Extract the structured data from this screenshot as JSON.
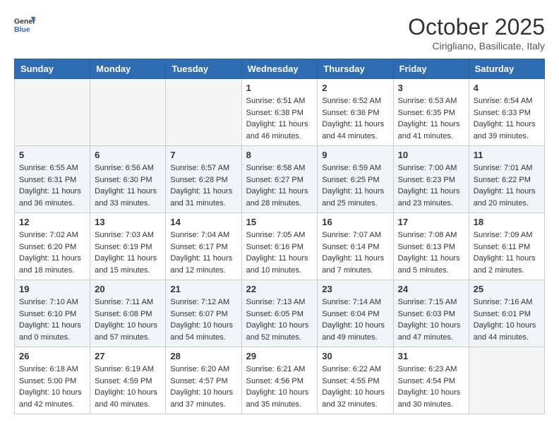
{
  "header": {
    "logo_general": "General",
    "logo_blue": "Blue",
    "month": "October 2025",
    "location": "Cirigliano, Basilicate, Italy"
  },
  "weekdays": [
    "Sunday",
    "Monday",
    "Tuesday",
    "Wednesday",
    "Thursday",
    "Friday",
    "Saturday"
  ],
  "weeks": [
    [
      {
        "day": "",
        "info": ""
      },
      {
        "day": "",
        "info": ""
      },
      {
        "day": "",
        "info": ""
      },
      {
        "day": "1",
        "info": "Sunrise: 6:51 AM\nSunset: 6:38 PM\nDaylight: 11 hours and 46 minutes."
      },
      {
        "day": "2",
        "info": "Sunrise: 6:52 AM\nSunset: 6:36 PM\nDaylight: 11 hours and 44 minutes."
      },
      {
        "day": "3",
        "info": "Sunrise: 6:53 AM\nSunset: 6:35 PM\nDaylight: 11 hours and 41 minutes."
      },
      {
        "day": "4",
        "info": "Sunrise: 6:54 AM\nSunset: 6:33 PM\nDaylight: 11 hours and 39 minutes."
      }
    ],
    [
      {
        "day": "5",
        "info": "Sunrise: 6:55 AM\nSunset: 6:31 PM\nDaylight: 11 hours and 36 minutes."
      },
      {
        "day": "6",
        "info": "Sunrise: 6:56 AM\nSunset: 6:30 PM\nDaylight: 11 hours and 33 minutes."
      },
      {
        "day": "7",
        "info": "Sunrise: 6:57 AM\nSunset: 6:28 PM\nDaylight: 11 hours and 31 minutes."
      },
      {
        "day": "8",
        "info": "Sunrise: 6:58 AM\nSunset: 6:27 PM\nDaylight: 11 hours and 28 minutes."
      },
      {
        "day": "9",
        "info": "Sunrise: 6:59 AM\nSunset: 6:25 PM\nDaylight: 11 hours and 25 minutes."
      },
      {
        "day": "10",
        "info": "Sunrise: 7:00 AM\nSunset: 6:23 PM\nDaylight: 11 hours and 23 minutes."
      },
      {
        "day": "11",
        "info": "Sunrise: 7:01 AM\nSunset: 6:22 PM\nDaylight: 11 hours and 20 minutes."
      }
    ],
    [
      {
        "day": "12",
        "info": "Sunrise: 7:02 AM\nSunset: 6:20 PM\nDaylight: 11 hours and 18 minutes."
      },
      {
        "day": "13",
        "info": "Sunrise: 7:03 AM\nSunset: 6:19 PM\nDaylight: 11 hours and 15 minutes."
      },
      {
        "day": "14",
        "info": "Sunrise: 7:04 AM\nSunset: 6:17 PM\nDaylight: 11 hours and 12 minutes."
      },
      {
        "day": "15",
        "info": "Sunrise: 7:05 AM\nSunset: 6:16 PM\nDaylight: 11 hours and 10 minutes."
      },
      {
        "day": "16",
        "info": "Sunrise: 7:07 AM\nSunset: 6:14 PM\nDaylight: 11 hours and 7 minutes."
      },
      {
        "day": "17",
        "info": "Sunrise: 7:08 AM\nSunset: 6:13 PM\nDaylight: 11 hours and 5 minutes."
      },
      {
        "day": "18",
        "info": "Sunrise: 7:09 AM\nSunset: 6:11 PM\nDaylight: 11 hours and 2 minutes."
      }
    ],
    [
      {
        "day": "19",
        "info": "Sunrise: 7:10 AM\nSunset: 6:10 PM\nDaylight: 11 hours and 0 minutes."
      },
      {
        "day": "20",
        "info": "Sunrise: 7:11 AM\nSunset: 6:08 PM\nDaylight: 10 hours and 57 minutes."
      },
      {
        "day": "21",
        "info": "Sunrise: 7:12 AM\nSunset: 6:07 PM\nDaylight: 10 hours and 54 minutes."
      },
      {
        "day": "22",
        "info": "Sunrise: 7:13 AM\nSunset: 6:05 PM\nDaylight: 10 hours and 52 minutes."
      },
      {
        "day": "23",
        "info": "Sunrise: 7:14 AM\nSunset: 6:04 PM\nDaylight: 10 hours and 49 minutes."
      },
      {
        "day": "24",
        "info": "Sunrise: 7:15 AM\nSunset: 6:03 PM\nDaylight: 10 hours and 47 minutes."
      },
      {
        "day": "25",
        "info": "Sunrise: 7:16 AM\nSunset: 6:01 PM\nDaylight: 10 hours and 44 minutes."
      }
    ],
    [
      {
        "day": "26",
        "info": "Sunrise: 6:18 AM\nSunset: 5:00 PM\nDaylight: 10 hours and 42 minutes."
      },
      {
        "day": "27",
        "info": "Sunrise: 6:19 AM\nSunset: 4:59 PM\nDaylight: 10 hours and 40 minutes."
      },
      {
        "day": "28",
        "info": "Sunrise: 6:20 AM\nSunset: 4:57 PM\nDaylight: 10 hours and 37 minutes."
      },
      {
        "day": "29",
        "info": "Sunrise: 6:21 AM\nSunset: 4:56 PM\nDaylight: 10 hours and 35 minutes."
      },
      {
        "day": "30",
        "info": "Sunrise: 6:22 AM\nSunset: 4:55 PM\nDaylight: 10 hours and 32 minutes."
      },
      {
        "day": "31",
        "info": "Sunrise: 6:23 AM\nSunset: 4:54 PM\nDaylight: 10 hours and 30 minutes."
      },
      {
        "day": "",
        "info": ""
      }
    ]
  ]
}
